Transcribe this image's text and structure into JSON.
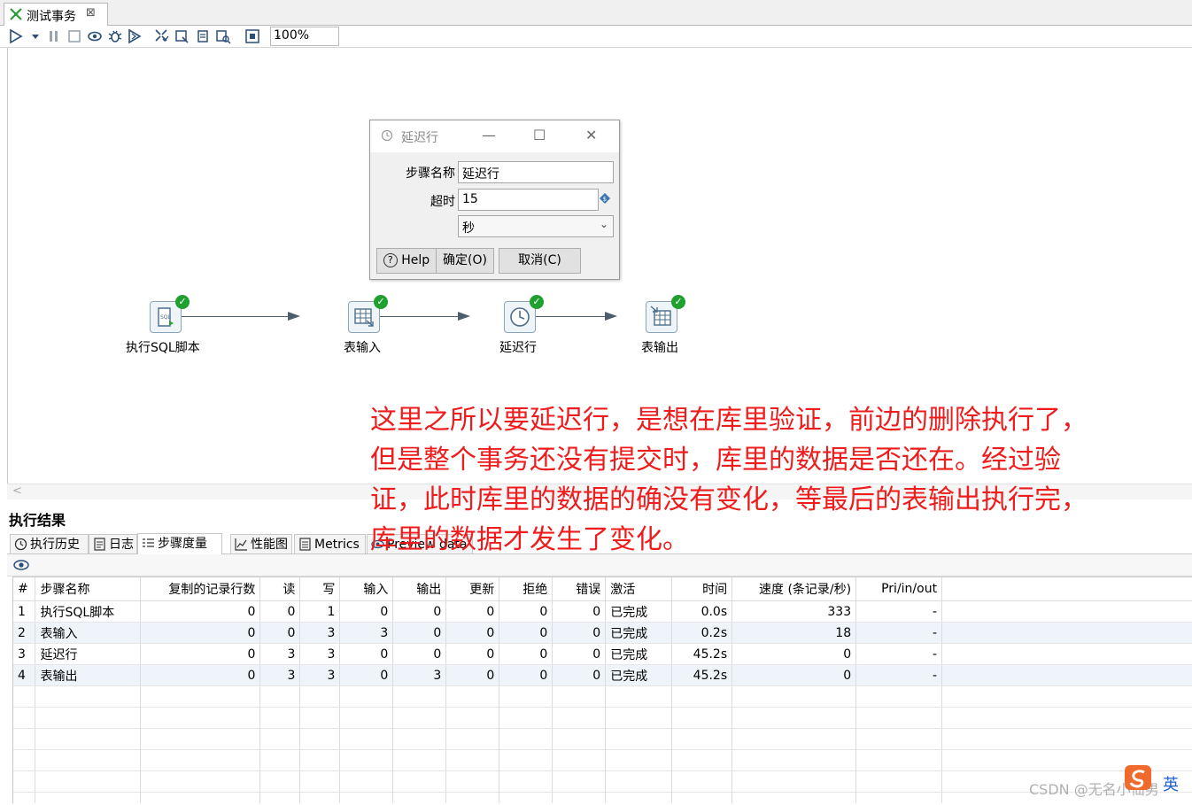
{
  "tab": {
    "title": "测试事务",
    "close": "⊠"
  },
  "toolbar": {
    "zoom": "100%"
  },
  "canvas": {
    "steps": [
      {
        "label": "执行SQL脚本",
        "icon": "sql-script-icon"
      },
      {
        "label": "表输入",
        "icon": "table-input-icon"
      },
      {
        "label": "延迟行",
        "icon": "clock-icon"
      },
      {
        "label": "表输出",
        "icon": "table-output-icon"
      }
    ]
  },
  "dialog": {
    "title": "延迟行",
    "step_name_label": "步骤名称",
    "step_name_value": "延迟行",
    "timeout_label": "超时",
    "timeout_value": "15",
    "unit_value": "秒",
    "help_label": "Help",
    "ok_label": "确定(O)",
    "cancel_label": "取消(C)"
  },
  "results": {
    "title": "执行结果",
    "tabs": [
      "执行历史",
      "日志",
      "步骤度量",
      "性能图",
      "Metrics",
      "Preview data"
    ],
    "columns": [
      "#",
      "步骤名称",
      "复制的记录行数",
      "读",
      "写",
      "输入",
      "输出",
      "更新",
      "拒绝",
      "错误",
      "激活",
      "时间",
      "速度 (条记录/秒)",
      "Pri/in/out"
    ],
    "rows": [
      [
        "1",
        "执行SQL脚本",
        "0",
        "0",
        "1",
        "0",
        "0",
        "0",
        "0",
        "0",
        "已完成",
        "0.0s",
        "333",
        "-"
      ],
      [
        "2",
        "表输入",
        "0",
        "0",
        "3",
        "3",
        "0",
        "0",
        "0",
        "0",
        "已完成",
        "0.2s",
        "18",
        "-"
      ],
      [
        "3",
        "延迟行",
        "0",
        "3",
        "3",
        "0",
        "0",
        "0",
        "0",
        "0",
        "已完成",
        "45.2s",
        "0",
        "-"
      ],
      [
        "4",
        "表输出",
        "0",
        "3",
        "3",
        "0",
        "3",
        "0",
        "0",
        "0",
        "已完成",
        "45.2s",
        "0",
        "-"
      ]
    ]
  },
  "annotation": {
    "lines": [
      "这里之所以要延迟行，是想在库里验证，前边的删除执行了，",
      "但是整个事务还没有提交时，库里的数据是否还在。经过验",
      "证，此时库里的数据的确没有变化，等最后的表输出执行完，",
      "库里的数据才发生了变化。"
    ]
  },
  "watermark": "CSDN @无名小仙男",
  "ime": "英"
}
